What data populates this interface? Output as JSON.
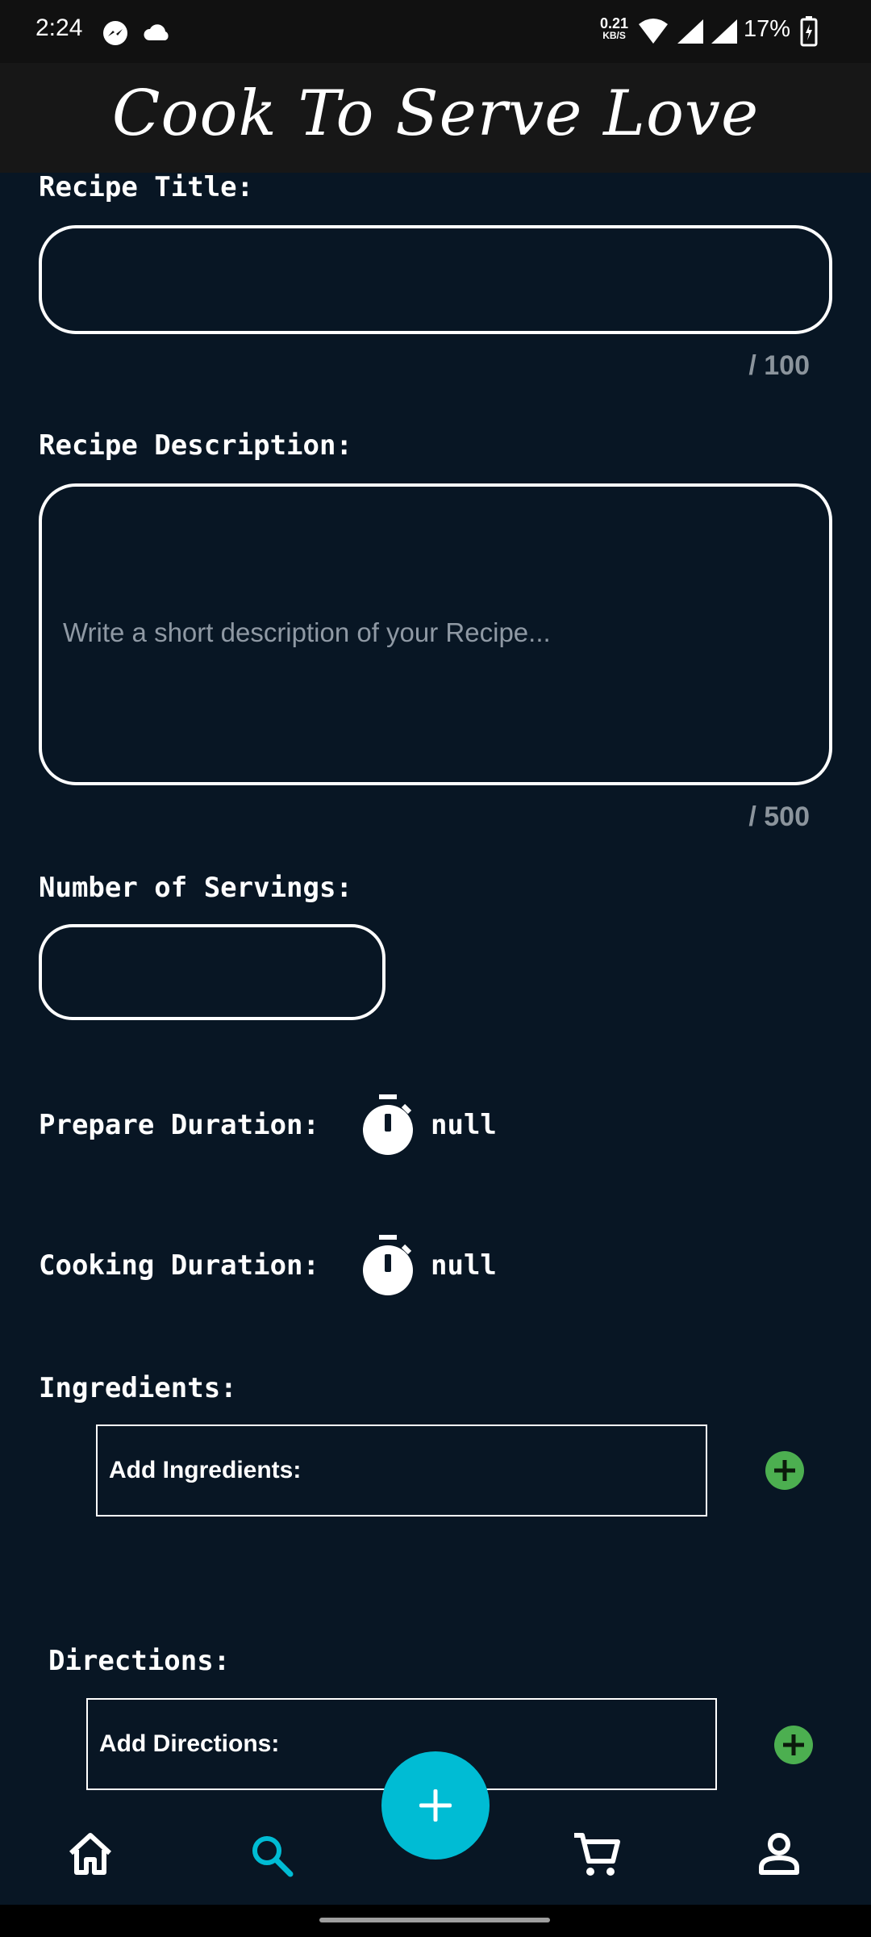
{
  "status_bar": {
    "time": "2:24",
    "network_speed_value": "0.21",
    "network_speed_unit": "KB/S",
    "battery": "17%"
  },
  "app": {
    "title": "Cook To Serve Love"
  },
  "form": {
    "recipe_title_label": "Recipe Title:",
    "recipe_title_value": "",
    "recipe_title_counter": "/ 100",
    "recipe_description_label": "Recipe Description:",
    "recipe_description_placeholder": "Write a short description of your Recipe...",
    "recipe_description_counter": "/ 500",
    "servings_label": "Number of Servings:",
    "servings_value": "",
    "prepare_label": "Prepare Duration:",
    "prepare_value": "null",
    "cooking_label": "Cooking Duration:",
    "cooking_value": "null",
    "ingredients_label": "Ingredients:",
    "ingredients_box": "Add Ingredients:",
    "directions_label": "Directions:",
    "directions_box": "Add Directions:"
  },
  "nav": {
    "items": [
      "home-icon",
      "search-icon",
      "cart-icon",
      "profile-icon"
    ],
    "active": "search",
    "active_color": "#00bcd4"
  },
  "colors": {
    "background": "#081624",
    "appbar": "#171717",
    "accent": "#00bcd4",
    "add_green": "#4caf50"
  }
}
